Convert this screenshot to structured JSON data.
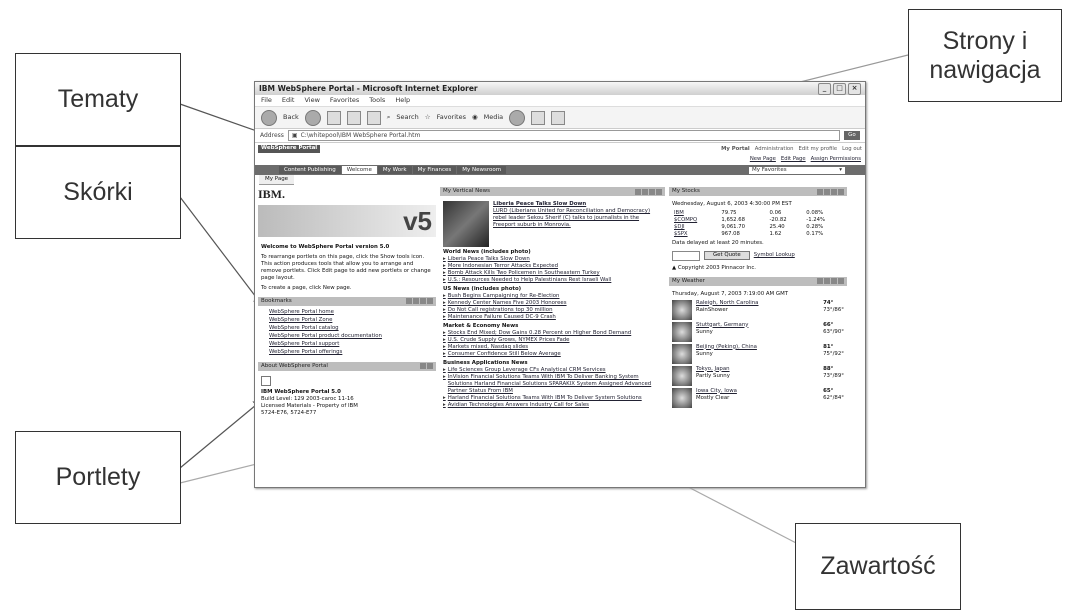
{
  "callouts": {
    "tematy": "Tematy",
    "strony": "Strony i\nnawigacja",
    "skorki": "Skórki",
    "portlety": "Portlety",
    "zawartosc": "Zawartość"
  },
  "browser": {
    "title": "IBM WebSphere Portal - Microsoft Internet Explorer",
    "menu": [
      "File",
      "Edit",
      "View",
      "Favorites",
      "Tools",
      "Help"
    ],
    "toolbar": {
      "back": "Back",
      "search": "Search",
      "favorites": "Favorites",
      "media": "Media"
    },
    "address_label": "Address",
    "address": "C:\\whitepool\\IBM WebSphere Portal.htm",
    "go": "Go"
  },
  "portal": {
    "logo": "WebSphere Portal",
    "header_links": [
      "My Portal",
      "Administration",
      "Edit my profile",
      "Log out"
    ],
    "sub_links": [
      "New Page",
      "Edit Page",
      "Assign Permissions"
    ],
    "tabs": [
      "Content Publishing",
      "Welcome",
      "My Work",
      "My Finances",
      "My Newsroom"
    ],
    "active_tab": "Welcome",
    "favorites": "My Favorites",
    "page_tab": "My Page"
  },
  "left": {
    "ibm": "IBM.",
    "version": "v5",
    "welcome": "Welcome to WebSphere Portal version 5.0",
    "desc": "To rearrange portlets on this page, click the Show tools icon. This action produces tools that allow you to arrange and remove portlets. Click Edit page to add new portlets or change page layout.",
    "create": "To create a page, click New page.",
    "bookmarks_title": "Bookmarks",
    "bookmarks": [
      "WebSphere Portal home",
      "WebSphere Portal Zone",
      "WebSphere Portal catalog",
      "WebSphere Portal product documentation",
      "WebSphere Portal support",
      "WebSphere Portal offerings"
    ],
    "about_title": "About WebSphere Portal",
    "about_product": "IBM WebSphere Portal 5.0",
    "about_build": "Build Level: 129 2003-caroc 11-16",
    "about_license": "Licensed Materials - Property of IBM",
    "about_numbers": "5724-E76, 5724-E77"
  },
  "news": {
    "title": "My Vertical News",
    "headline": "Liberia Peace Talks Slow Down",
    "headline_body": "LURD (Liberians United for Reconciliation and Democracy) rebel leader Sekou Sherif (C) talks to journalists in the Freeport suburb in Monrovia.",
    "sections": [
      {
        "name": "World News (includes photo)",
        "items": [
          "Liberia Peace Talks Slow Down",
          "More Indonesian Terror Attacks Expected",
          "Bomb Attack Kills Two Policemen in Southeastern Turkey",
          "U.S.: Resources Needed to Help Palestinians Rest Israeli Wall"
        ]
      },
      {
        "name": "US News (includes photo)",
        "items": [
          "Bush Begins Campaigning for Re-Election",
          "Kennedy Center Names Five 2003 Honorees",
          "Do Not Call registrations top 30 million",
          "Maintenance Failure Caused DC-9 Crash"
        ]
      },
      {
        "name": "Market & Economy News",
        "items": [
          "Stocks End Mixed; Dow Gains 0.28 Percent on Higher Bond Demand",
          "U.S. Crude Supply Grows, NYMEX Prices Fade",
          "Markets mixed, Nasdaq slides",
          "Consumer Confidence Still Below Average"
        ]
      },
      {
        "name": "Business Applications News",
        "items": [
          "Life Sciences Group Leverage CFs Analytical CRM Services",
          "InVision Financial Solutions Teams With IBM To Deliver Banking System Solutions Harland Financial Solutions SPARAKIX System Assigned Advanced Partner Status From IBM",
          "Harland Financial Solutions Teams With IBM To Deliver System Solutions",
          "Avidian Technologies Answers Industry Call for Sales"
        ]
      }
    ]
  },
  "stocks": {
    "title": "My Stocks",
    "date": "Wednesday, August 6, 2003 4:30:00 PM EST",
    "rows": [
      {
        "sym": "IBM",
        "price": "79.75",
        "chg": "0.06",
        "pct": "0.08%"
      },
      {
        "sym": "$COMPQ",
        "price": "1,652.68",
        "chg": "-20.82",
        "pct": "-1.24%"
      },
      {
        "sym": "$DJI",
        "price": "9,061.70",
        "chg": "25.40",
        "pct": "0.28%"
      },
      {
        "sym": "$SPX",
        "price": "967.08",
        "chg": "1.62",
        "pct": "0.17%"
      }
    ],
    "delay": "Data delayed at least 20 minutes.",
    "get_quote": "Get Quote",
    "symbol_lookup": "Symbol Lookup",
    "copyright": "Copyright 2003 Pinnacor Inc."
  },
  "weather": {
    "title": "My Weather",
    "date": "Thursday, August 7, 2003 7:19:00 AM GMT",
    "rows": [
      {
        "city": "Raleigh, North Carolina",
        "cond": "RainShower",
        "now": "74°",
        "range": "73°/86°"
      },
      {
        "city": "Stuttgart, Germany",
        "cond": "Sunny",
        "now": "66°",
        "range": "63°/90°"
      },
      {
        "city": "Beijing (Peking), China",
        "cond": "Sunny",
        "now": "81°",
        "range": "75°/92°"
      },
      {
        "city": "Tokyo, Japan",
        "cond": "Partly Sunny",
        "now": "88°",
        "range": "73°/89°"
      },
      {
        "city": "Iowa City, Iowa",
        "cond": "Mostly Clear",
        "now": "65°",
        "range": "62°/84°"
      }
    ]
  }
}
